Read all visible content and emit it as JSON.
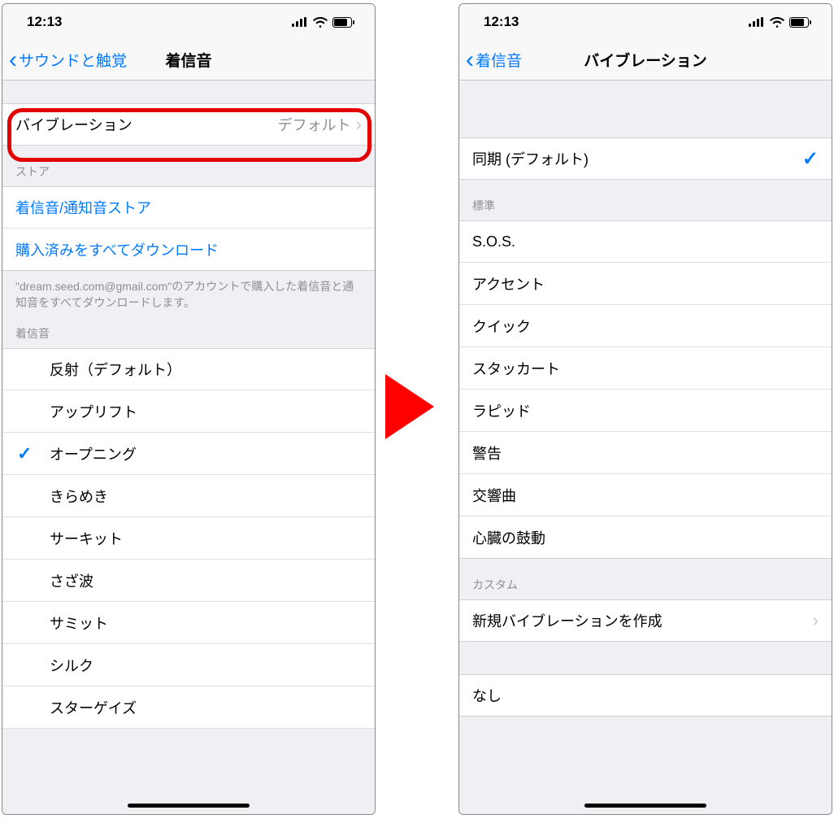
{
  "status": {
    "time": "12:13"
  },
  "left": {
    "back_label": "サウンドと触覚",
    "title": "着信音",
    "vibration": {
      "label": "バイブレーション",
      "value": "デフォルト"
    },
    "store_header": "ストア",
    "store_link1": "着信音/通知音ストア",
    "store_link2": "購入済みをすべてダウンロード",
    "store_footer": "\"dream.seed.com@gmail.com\"のアカウントで購入した着信音と通知音をすべてダウンロードします。",
    "ringtone_header": "着信音",
    "ringtones": [
      "反射（デフォルト）",
      "アップリフト",
      "オープニング",
      "きらめき",
      "サーキット",
      "さざ波",
      "サミット",
      "シルク",
      "スターゲイズ"
    ],
    "selected_index": 2
  },
  "right": {
    "back_label": "着信音",
    "title": "バイブレーション",
    "sync_label": "同期 (デフォルト)",
    "standard_header": "標準",
    "standard": [
      "S.O.S.",
      "アクセント",
      "クイック",
      "スタッカート",
      "ラピッド",
      "警告",
      "交響曲",
      "心臓の鼓動"
    ],
    "custom_header": "カスタム",
    "custom_create": "新規バイブレーションを作成",
    "none_label": "なし"
  }
}
